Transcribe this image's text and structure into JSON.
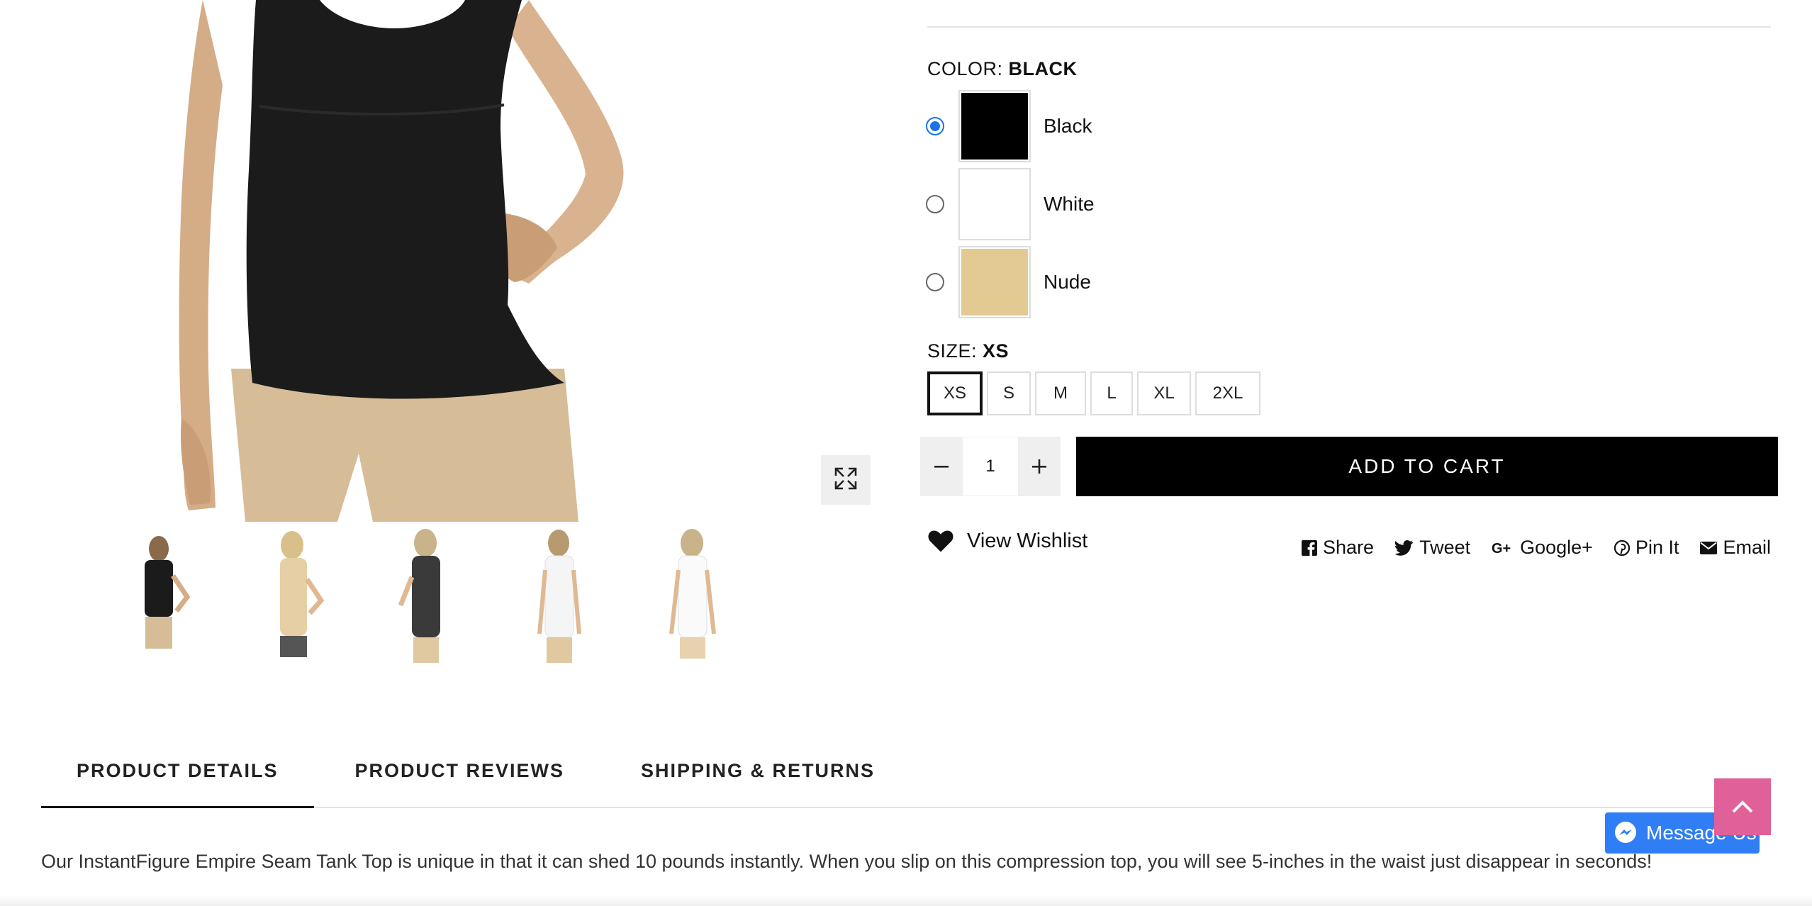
{
  "product": {
    "color_option": {
      "label": "COLOR:",
      "selected": "BLACK"
    },
    "colors": [
      {
        "name": "Black",
        "swatch": "#000000",
        "checked": true
      },
      {
        "name": "White",
        "swatch": "#ffffff",
        "checked": false
      },
      {
        "name": "Nude",
        "swatch": "#e3ca92",
        "checked": false
      }
    ],
    "size_option": {
      "label": "SIZE:",
      "selected": "XS"
    },
    "sizes": [
      "XS",
      "S",
      "M",
      "L",
      "XL",
      "2XL"
    ],
    "quantity": "1",
    "add_to_cart": "ADD TO CART",
    "wishlist": "View Wishlist"
  },
  "share": [
    {
      "label": "Share",
      "icon": "facebook-icon"
    },
    {
      "label": "Tweet",
      "icon": "twitter-icon"
    },
    {
      "label": "Google+",
      "icon": "google-plus-icon"
    },
    {
      "label": "Pin It",
      "icon": "pinterest-icon"
    },
    {
      "label": "Email",
      "icon": "email-icon"
    }
  ],
  "tabs": [
    {
      "label": "PRODUCT DETAILS",
      "active": true
    },
    {
      "label": "PRODUCT REVIEWS",
      "active": false
    },
    {
      "label": "SHIPPING & RETURNS",
      "active": false
    }
  ],
  "description": "Our InstantFigure Empire Seam Tank Top is unique in that it can shed 10 pounds instantly. When you slip on this compression top, you will see 5-inches in the waist just disappear in seconds!",
  "messenger": {
    "label": "Message Us"
  },
  "colors_theme": {
    "accent": "#000000",
    "radio": "#1a73e8",
    "back_to_top": "#e0609a",
    "messenger": "#2f7ef6"
  }
}
